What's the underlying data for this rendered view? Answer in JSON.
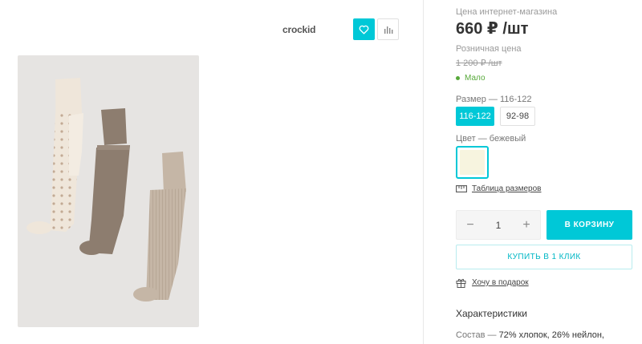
{
  "header": {
    "brand": "crockid",
    "favorite_icon": "heart-icon",
    "compare_icon": "bar-chart-icon"
  },
  "product": {
    "online_price_label": "Цена интернет-магазина",
    "price": "660 ₽ /шт",
    "retail_label": "Розничная цена",
    "retail_price": "1 200 ₽ /шт",
    "stock_status": "Мало",
    "size_label": "Размер",
    "size_selected": "116-122",
    "sizes": [
      "116-122",
      "92-98"
    ],
    "color_label": "Цвет",
    "color_selected": "бежевый",
    "swatch_color": "#f7f4df",
    "size_table_link": "Таблица размеров",
    "quantity": "1",
    "add_to_cart": "В КОРЗИНУ",
    "buy_one_click": "КУПИТЬ В 1 КЛИК",
    "gift_link": "Хочу в подарок",
    "characteristics_title": "Характеристики",
    "composition_label": "Состав",
    "composition_value": "72% хлопок, 26% нейлон,"
  },
  "colors": {
    "accent": "#00c8d7",
    "stock_green": "#57a93a"
  }
}
